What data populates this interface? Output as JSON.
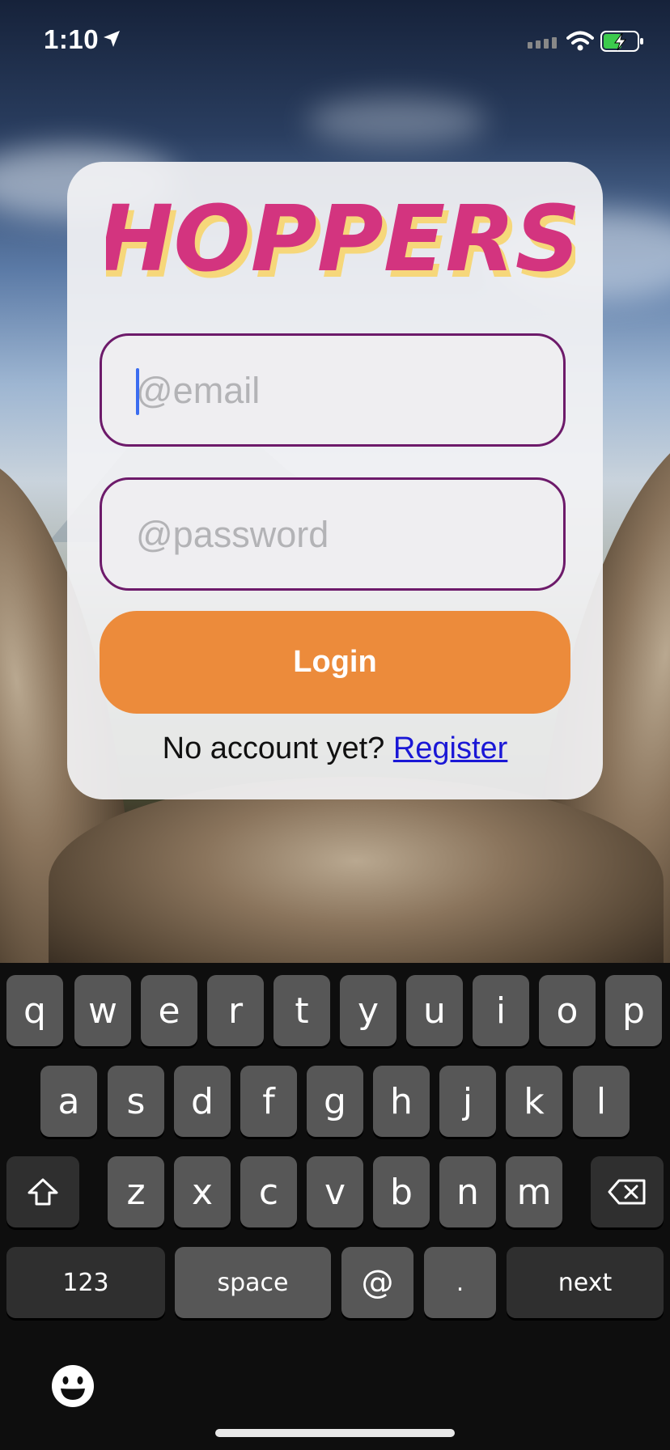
{
  "status_bar": {
    "time": "1:10"
  },
  "app": {
    "logo_text": "HOPPERS",
    "colors": {
      "brand": "#d3347f",
      "logo_shadow": "#f6d77a",
      "accent": "#ec8b3b",
      "field_border": "#6d1a6a",
      "link": "#1a17d6"
    }
  },
  "form": {
    "email": {
      "value": "",
      "placeholder": "@email"
    },
    "password": {
      "value": "",
      "placeholder": "@password"
    },
    "login_label": "Login",
    "signup_prompt": "No account yet?",
    "signup_link": "Register"
  },
  "keyboard": {
    "row1": [
      "q",
      "w",
      "e",
      "r",
      "t",
      "y",
      "u",
      "i",
      "o",
      "p"
    ],
    "row2": [
      "a",
      "s",
      "d",
      "f",
      "g",
      "h",
      "j",
      "k",
      "l"
    ],
    "row3": [
      "z",
      "x",
      "c",
      "v",
      "b",
      "n",
      "m"
    ],
    "bottom": {
      "numbers": "123",
      "space": "space",
      "at": "@",
      "dot": ".",
      "next": "next"
    },
    "icons": [
      "shift-icon",
      "backspace-icon",
      "emoji-icon"
    ]
  }
}
